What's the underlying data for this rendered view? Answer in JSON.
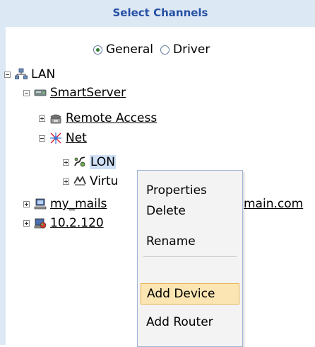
{
  "header": {
    "title": "Select Channels"
  },
  "mode": {
    "options": [
      {
        "label": "General",
        "checked": true
      },
      {
        "label": "Driver",
        "checked": false
      }
    ]
  },
  "tree": {
    "lan": {
      "label": "LAN",
      "icon": "network-icon"
    },
    "smartserver": {
      "label": "SmartServer",
      "icon": "server-icon"
    },
    "remote_access": {
      "label": "Remote Access",
      "icon": "telephone-icon"
    },
    "net": {
      "label": "Net",
      "icon": "network-hub-icon"
    },
    "lon": {
      "label": "LON",
      "icon": "lon-channel-icon"
    },
    "virtual": {
      "label": "Virtu",
      "icon": "virtual-channel-icon"
    },
    "mail": {
      "label": "my_mails",
      "label_tail": "main.com",
      "icon": "computer-icon"
    },
    "ip": {
      "label": "10.2.120",
      "icon": "computer-globe-icon"
    }
  },
  "context_menu": {
    "items": [
      "Properties",
      "Delete",
      "Rename",
      "Add Device",
      "Add Router"
    ],
    "highlighted": "Add Device"
  },
  "colors": {
    "header_bg": "#dde8f5",
    "header_text": "#2550a4",
    "selection_bg": "#cfe0f7",
    "menu_highlight": "#fbe6b3"
  }
}
